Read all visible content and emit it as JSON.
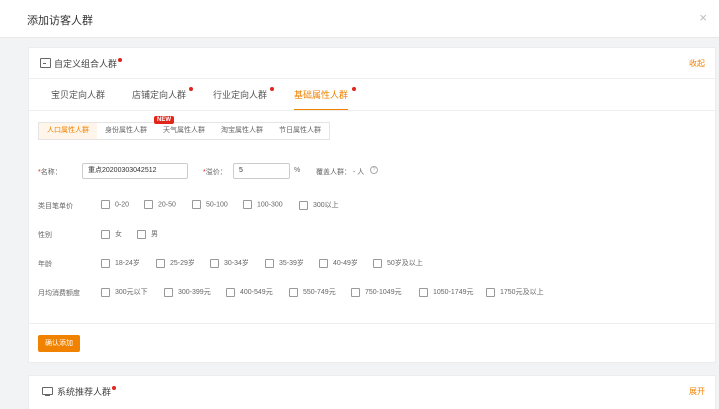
{
  "modal": {
    "title": "添加访客人群",
    "close": "×"
  },
  "panel1": {
    "title": "自定义组合人群",
    "collapse": "收起",
    "tabs": [
      {
        "label": "宝贝定向人群"
      },
      {
        "label": "店铺定向人群"
      },
      {
        "label": "行业定向人群"
      },
      {
        "label": "基础属性人群"
      }
    ],
    "subtabs": [
      {
        "label": "人口属性人群"
      },
      {
        "label": "身份属性人群"
      },
      {
        "label": "天气属性人群"
      },
      {
        "label": "淘宝属性人群"
      },
      {
        "label": "节日属性人群"
      }
    ],
    "new_badge": "NEW",
    "form": {
      "name_label": "名称：",
      "name_value": "重点20200303042512",
      "premium_label": "溢价：",
      "premium_value": "5",
      "premium_unit": "%",
      "cover_label": "覆盖人群：",
      "cover_value": "- 人",
      "help": "?"
    },
    "rows": [
      {
        "label": "类目笔单价",
        "options": [
          "0-20",
          "20-50",
          "50-100",
          "100-300",
          "300以上"
        ]
      },
      {
        "label": "性别",
        "options": [
          "女",
          "男"
        ]
      },
      {
        "label": "年龄",
        "options": [
          "18-24岁",
          "25-29岁",
          "30-34岁",
          "35-39岁",
          "40-49岁",
          "50岁及以上"
        ]
      },
      {
        "label": "月均消费额度",
        "options": [
          "300元以下",
          "300-399元",
          "400-549元",
          "550-749元",
          "750-1049元",
          "1050-1749元",
          "1750元及以上"
        ]
      }
    ],
    "confirm": "确认添加"
  },
  "panel2": {
    "title": "系统推荐人群",
    "expand": "展开"
  },
  "colors": {
    "accent": "#f08200",
    "dot": "#e1251b"
  }
}
